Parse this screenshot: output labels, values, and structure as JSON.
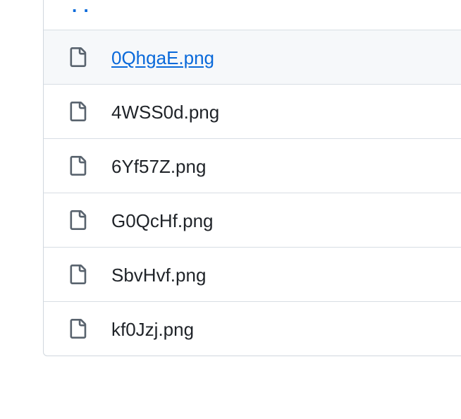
{
  "parent_directory": {
    "label": ". ."
  },
  "files": [
    {
      "name": "0QhgaE.png",
      "icon": "file-icon",
      "hovered": true
    },
    {
      "name": "4WSS0d.png",
      "icon": "file-icon",
      "hovered": false
    },
    {
      "name": "6Yf57Z.png",
      "icon": "file-icon",
      "hovered": false
    },
    {
      "name": "G0QcHf.png",
      "icon": "file-icon",
      "hovered": false
    },
    {
      "name": "SbvHvf.png",
      "icon": "file-icon",
      "hovered": false
    },
    {
      "name": "kf0Jzj.png",
      "icon": "file-icon",
      "hovered": false
    }
  ],
  "colors": {
    "link": "#0969da",
    "text": "#1f2328",
    "icon": "#59636e",
    "border": "#d0d7de",
    "hover_bg": "#f6f8fa"
  }
}
